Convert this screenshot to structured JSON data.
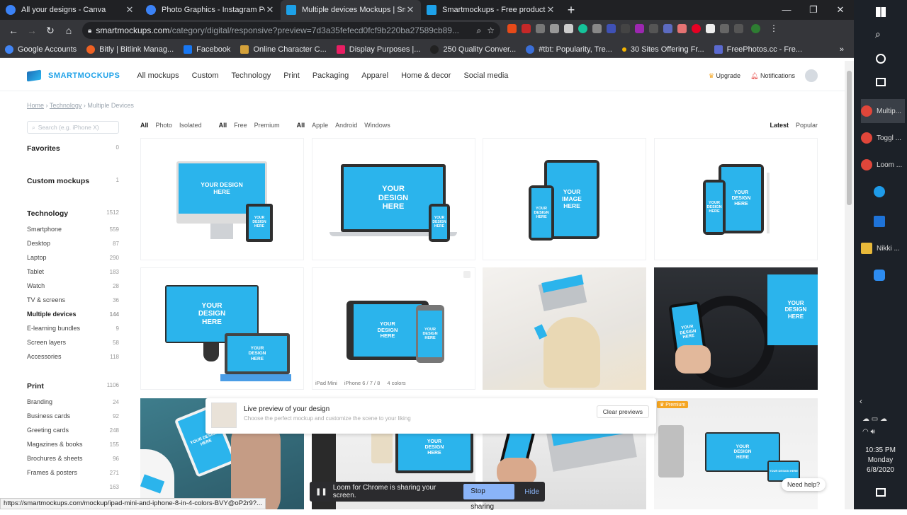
{
  "tabs": [
    {
      "title": "All your designs - Canva",
      "color": "#3b82f6"
    },
    {
      "title": "Photo Graphics - Instagram Post",
      "color": "#3b82f6"
    },
    {
      "title": "Multiple devices Mockups | Smar",
      "color": "#1da1e8"
    },
    {
      "title": "Smartmockups - Free product m",
      "color": "#1da1e8"
    }
  ],
  "address": {
    "host": "smartmockups.com",
    "path": "/category/digital/responsive?preview=7d3a35fefecd0fcf9b220ba27589cb89..."
  },
  "bookmarks": [
    "Google Accounts",
    "Bitly | Bitlink Manag...",
    "Facebook",
    "Online Character C...",
    "Display Purposes |...",
    "250 Quality Conver...",
    "#tbt: Popularity, Tre...",
    "30 Sites Offering Fr...",
    "FreePhotos.cc - Fre..."
  ],
  "site": {
    "logo": "SMARTMOCKUPS",
    "menu": [
      "All mockups",
      "Custom",
      "Technology",
      "Print",
      "Packaging",
      "Apparel",
      "Home & decor",
      "Social media"
    ],
    "upgrade": "Upgrade",
    "notifications": "Notifications",
    "breadcrumb": [
      "Home",
      "Technology",
      "Multiple Devices"
    ],
    "search_placeholder": "Search (e.g. iPhone X)",
    "filters": {
      "type": [
        "All",
        "Photo",
        "Isolated"
      ],
      "tier": [
        "All",
        "Free",
        "Premium"
      ],
      "brand": [
        "All",
        "Apple",
        "Android",
        "Windows"
      ]
    },
    "sort": [
      "Latest",
      "Popular"
    ],
    "sidebar": {
      "favorites": {
        "label": "Favorites",
        "count": "0"
      },
      "custom": {
        "label": "Custom mockups",
        "count": "1"
      },
      "technology": {
        "label": "Technology",
        "count": "1512"
      },
      "tech_items": [
        {
          "label": "Smartphone",
          "count": "559"
        },
        {
          "label": "Desktop",
          "count": "87"
        },
        {
          "label": "Laptop",
          "count": "290"
        },
        {
          "label": "Tablet",
          "count": "183"
        },
        {
          "label": "Watch",
          "count": "28"
        },
        {
          "label": "TV & screens",
          "count": "36"
        },
        {
          "label": "Multiple devices",
          "count": "144"
        },
        {
          "label": "E-learning bundles",
          "count": "9"
        },
        {
          "label": "Screen layers",
          "count": "58"
        },
        {
          "label": "Accessories",
          "count": "118"
        }
      ],
      "print": {
        "label": "Print",
        "count": "1106"
      },
      "print_items": [
        {
          "label": "Branding",
          "count": "24"
        },
        {
          "label": "Business cards",
          "count": "92"
        },
        {
          "label": "Greeting cards",
          "count": "248"
        },
        {
          "label": "Magazines & books",
          "count": "155"
        },
        {
          "label": "Brochures & sheets",
          "count": "96"
        },
        {
          "label": "Frames & posters",
          "count": "271"
        },
        {
          "label": "",
          "count": "163"
        }
      ]
    },
    "screen_text": {
      "design": "YOUR DESIGN HERE",
      "image": "YOUR IMAGE HERE"
    },
    "card_tags": [
      "iPad Mini",
      "iPhone 6 / 7 / 8",
      "4 colors"
    ],
    "premium_badge": "Premium",
    "preview": {
      "title": "Live preview of your design",
      "subtitle": "Choose the perfect mockup and customize the scene to your liking",
      "clear": "Clear previews"
    },
    "need_help": "Need help?"
  },
  "loom": {
    "text": "Loom for Chrome is sharing your screen.",
    "stop": "Stop sharing",
    "hide": "Hide"
  },
  "status_url": "https://smartmockups.com/mockup/ipad-mini-and-iphone-8-in-4-colors-BVY@oP2r9?...",
  "taskbar": {
    "items": [
      {
        "label": "Multip...",
        "color": "#e0463a"
      },
      {
        "label": "Toggl ...",
        "color": "#e0463a"
      },
      {
        "label": "Loom ...",
        "color": "#e0463a"
      },
      {
        "label": "",
        "color": "#1e9be9"
      },
      {
        "label": "",
        "color": "#1e73d8"
      },
      {
        "label": "Nikki ...",
        "color": "#e8b93a"
      },
      {
        "label": "",
        "color": "#2d8cf0"
      }
    ],
    "time": "10:35 PM",
    "day": "Monday",
    "date": "6/8/2020"
  },
  "colors": {
    "accent": "#1da1e8",
    "screen": "#2bb4ec",
    "chrome_dark": "#202124"
  }
}
